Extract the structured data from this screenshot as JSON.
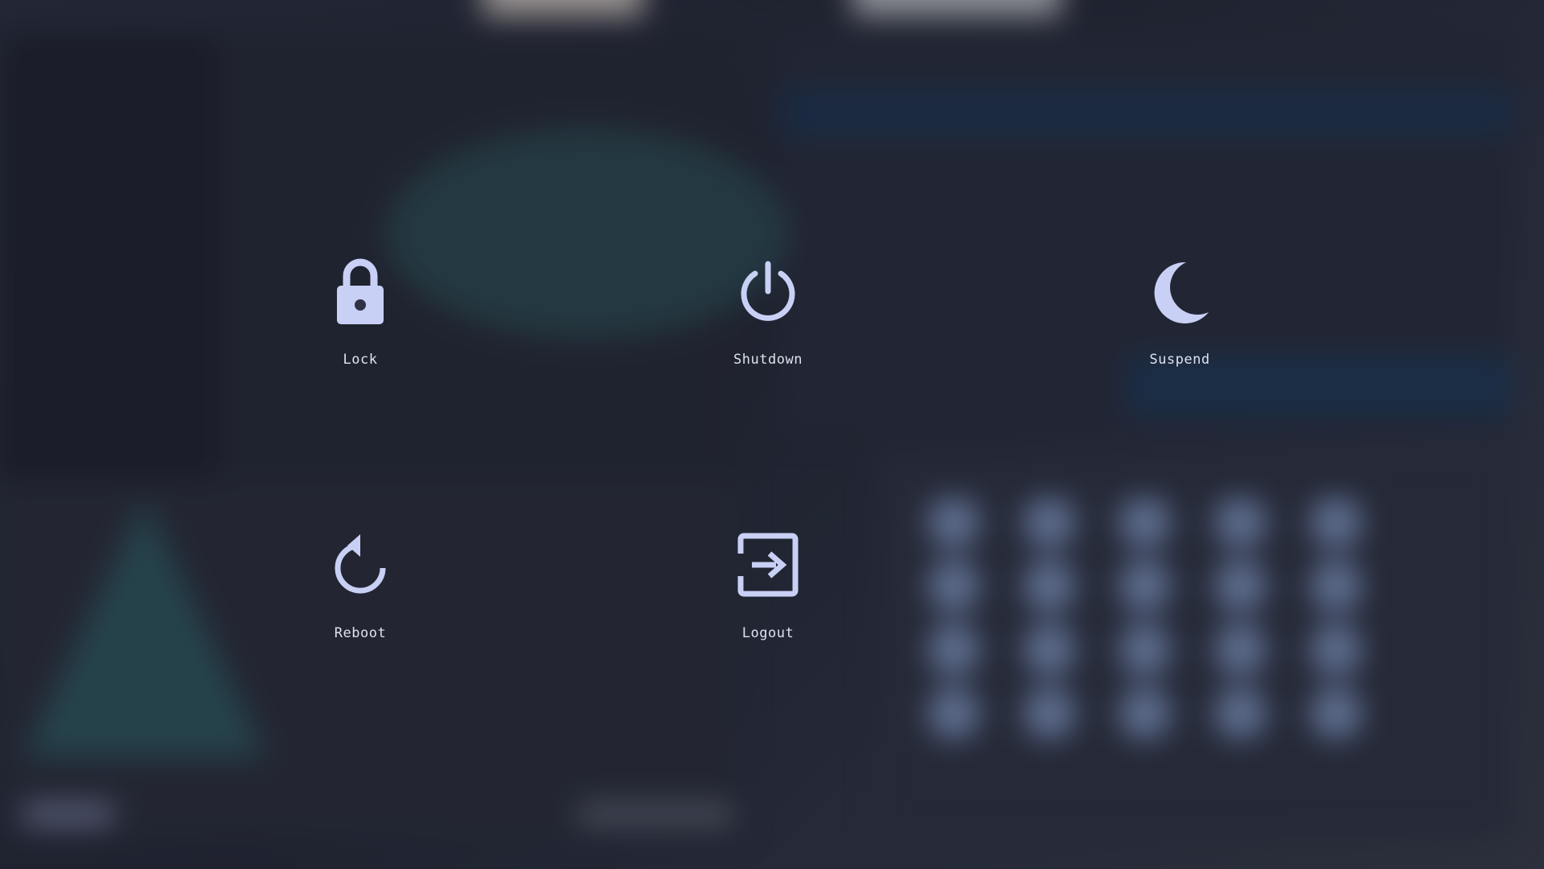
{
  "power_menu": {
    "accent_color": "#c9d0f5",
    "items": [
      {
        "id": "lock",
        "label": "Lock",
        "icon": "lock-icon"
      },
      {
        "id": "shutdown",
        "label": "Shutdown",
        "icon": "power-icon"
      },
      {
        "id": "suspend",
        "label": "Suspend",
        "icon": "moon-icon"
      },
      {
        "id": "reboot",
        "label": "Reboot",
        "icon": "reboot-icon"
      },
      {
        "id": "logout",
        "label": "Logout",
        "icon": "logout-icon"
      }
    ]
  }
}
